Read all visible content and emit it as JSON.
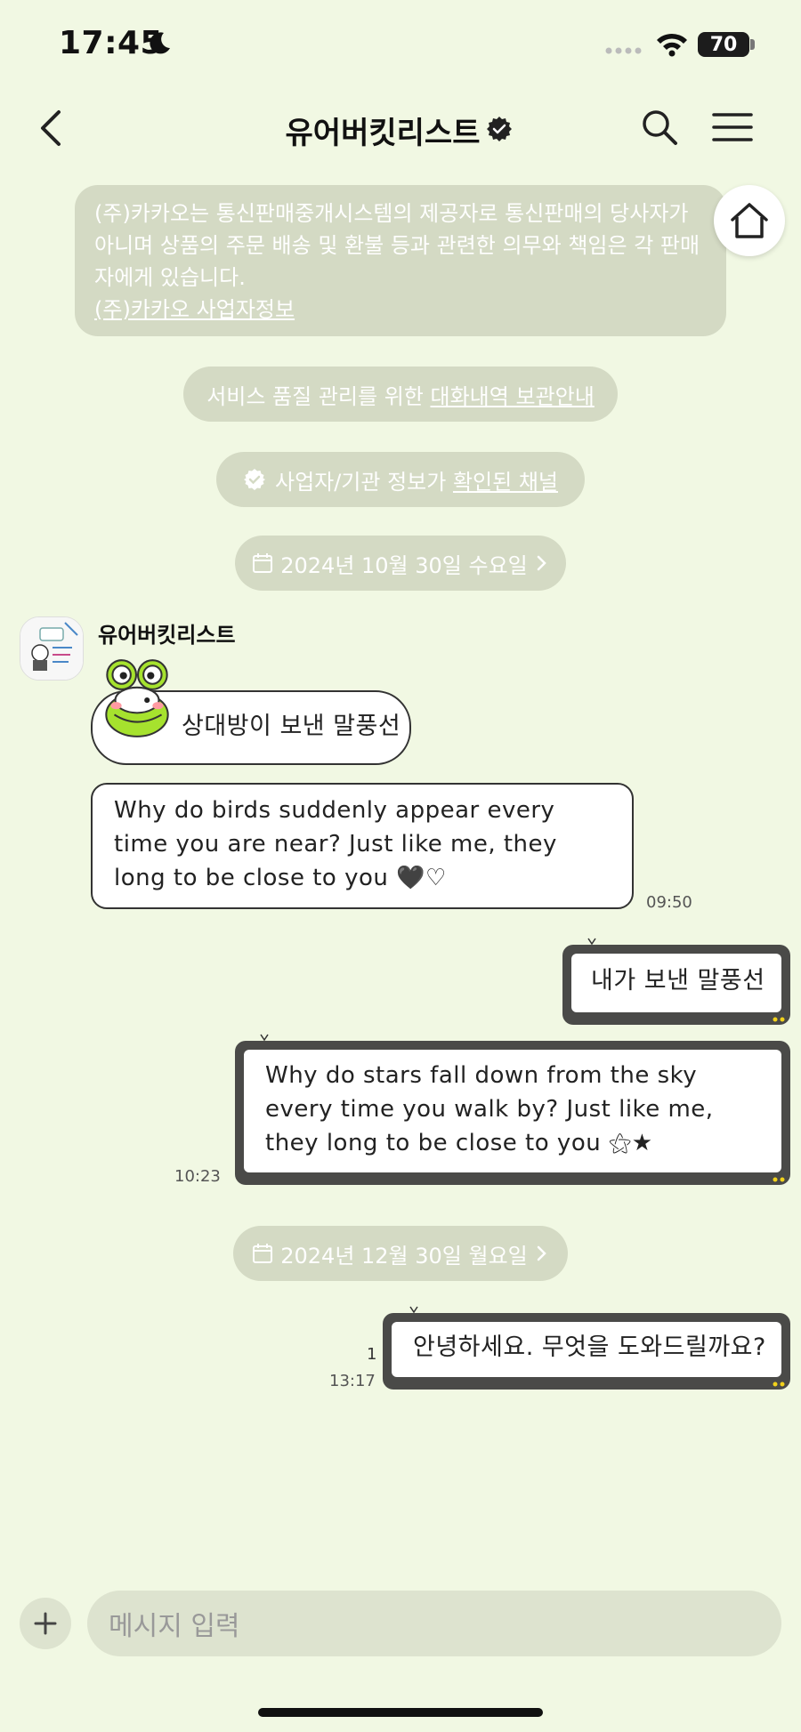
{
  "status_bar": {
    "time": "17:45",
    "battery": "70"
  },
  "nav": {
    "title": "유어버킷리스트"
  },
  "notices": {
    "commerce_line1": "(주)카카오는 통신판매중개시스템의 제공자로 통신판매의 당사자가",
    "commerce_line2": "아니며 상품의 주문 배송 및 환불 등과 관련한 의무와 책임은 각 판매",
    "commerce_line3": "자에게 있습니다.",
    "commerce_link": "(주)카카오 사업자정보",
    "quality_prefix": "서비스 품질 관리를 위한 ",
    "quality_link": "대화내역 보관안내",
    "verified_prefix": "사업자/기관 정보가 ",
    "verified_link": "확인된 채널"
  },
  "dates": {
    "first": "2024년 10월 30일 수요일",
    "second": "2024년 12월 30일 월요일"
  },
  "chat": {
    "sender": "유어버킷리스트",
    "incoming_1": "상대방이 보낸 말풍선",
    "incoming_2_line1": "Why do birds suddenly appear every",
    "incoming_2_line2": "time you are near? Just like me, they",
    "incoming_2_line3": "long to be close to you 🖤♡",
    "incoming_time": "09:50",
    "outgoing_1": "내가 보낸 말풍선",
    "outgoing_2_line1": "Why do stars fall down from the sky",
    "outgoing_2_line2": "every time you walk by? Just like me,",
    "outgoing_2_line3": "they long to be close to you ⚝★",
    "outgoing_time": "10:23",
    "outgoing_3": "안녕하세요. 무엇을 도와드릴까요?",
    "outgoing_3_unread": "1",
    "outgoing_3_time": "13:17"
  },
  "input": {
    "placeholder": "메시지 입력"
  },
  "colors": {
    "background": "#f1f8e3",
    "notice": "#d4dac4",
    "bubble_frame": "#4a4a48",
    "accent_dots": "#f2d21b",
    "frog_green": "#a6e22e"
  }
}
